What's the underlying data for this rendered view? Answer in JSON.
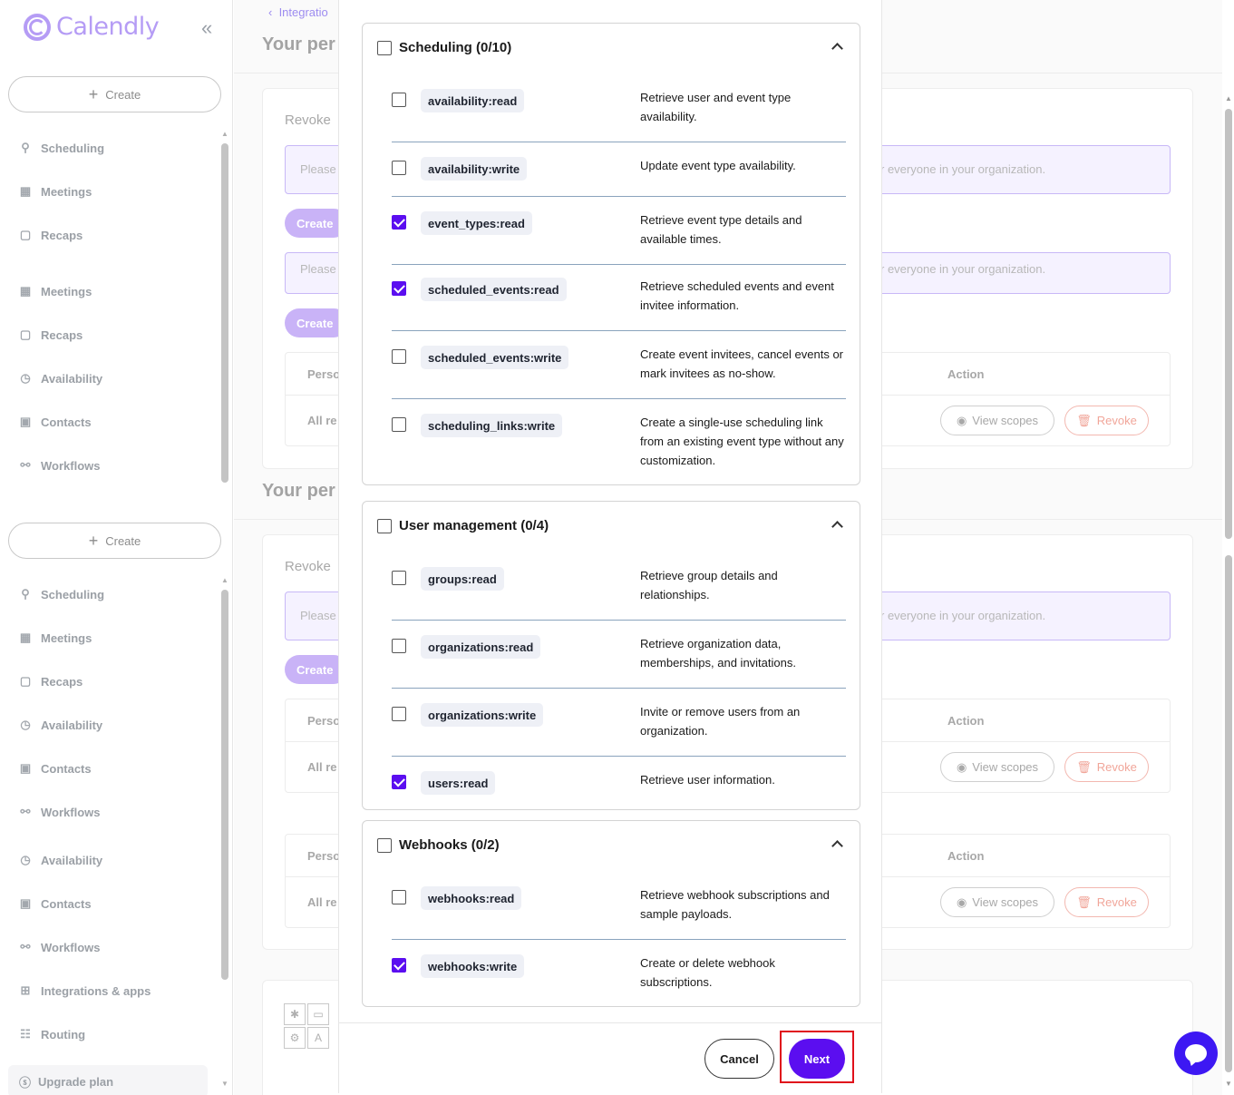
{
  "sidebar": {
    "brand": "Calendly",
    "create_label": "Create",
    "nav_a": [
      "Scheduling",
      "Meetings",
      "Recaps",
      "Meetings",
      "Recaps",
      "Availability",
      "Contacts",
      "Workflows"
    ],
    "nav_b": [
      "Scheduling",
      "Meetings",
      "Recaps",
      "Availability",
      "Contacts",
      "Workflows",
      "Availability",
      "Contacts",
      "Workflows",
      "Integrations & apps",
      "Routing"
    ],
    "upgrade_label": "Upgrade plan"
  },
  "main": {
    "breadcrumb": "Integratio",
    "page_title": "Your per",
    "revoke_label": "Revoke",
    "notice_left": "Please",
    "notice_right": "r everyone in your organization.",
    "create_label": "Create",
    "col_person": "Perso",
    "col_action": "Action",
    "row_label": "All re",
    "view_scopes": "View scopes",
    "revoke_btn": "Revoke"
  },
  "modal": {
    "groups": [
      {
        "title": "Scheduling (0/10)",
        "checked": false,
        "scopes": [
          {
            "name": "availability:read",
            "desc": "Retrieve user and event type availability.",
            "checked": false
          },
          {
            "name": "availability:write",
            "desc": "Update event type availability.",
            "checked": false
          },
          {
            "name": "event_types:read",
            "desc": "Retrieve event type details and available times.",
            "checked": true
          },
          {
            "name": "scheduled_events:read",
            "desc": "Retrieve scheduled events and event invitee information.",
            "checked": true
          },
          {
            "name": "scheduled_events:write",
            "desc": "Create event invitees, cancel events or mark invitees as no-show.",
            "checked": false
          },
          {
            "name": "scheduling_links:write",
            "desc": "Create a single-use scheduling link from an existing event type without any customization.",
            "checked": false
          }
        ]
      },
      {
        "title": "User management (0/4)",
        "checked": false,
        "scopes": [
          {
            "name": "groups:read",
            "desc": "Retrieve group details and relationships.",
            "checked": false
          },
          {
            "name": "organizations:read",
            "desc": "Retrieve organization data, memberships, and invitations.",
            "checked": false
          },
          {
            "name": "organizations:write",
            "desc": "Invite or remove users from an organization.",
            "checked": false
          },
          {
            "name": "users:read",
            "desc": "Retrieve user information.",
            "checked": true
          }
        ]
      },
      {
        "title": "Webhooks (0/2)",
        "checked": false,
        "scopes": [
          {
            "name": "webhooks:read",
            "desc": "Retrieve webhook subscriptions and sample payloads.",
            "checked": false
          },
          {
            "name": "webhooks:write",
            "desc": "Create or delete webhook subscriptions.",
            "checked": true
          }
        ]
      }
    ],
    "cancel_label": "Cancel",
    "next_label": "Next"
  },
  "colors": {
    "accent": "#5b0ef0",
    "highlight": "#e0101b",
    "chat": "#3d18f3"
  }
}
